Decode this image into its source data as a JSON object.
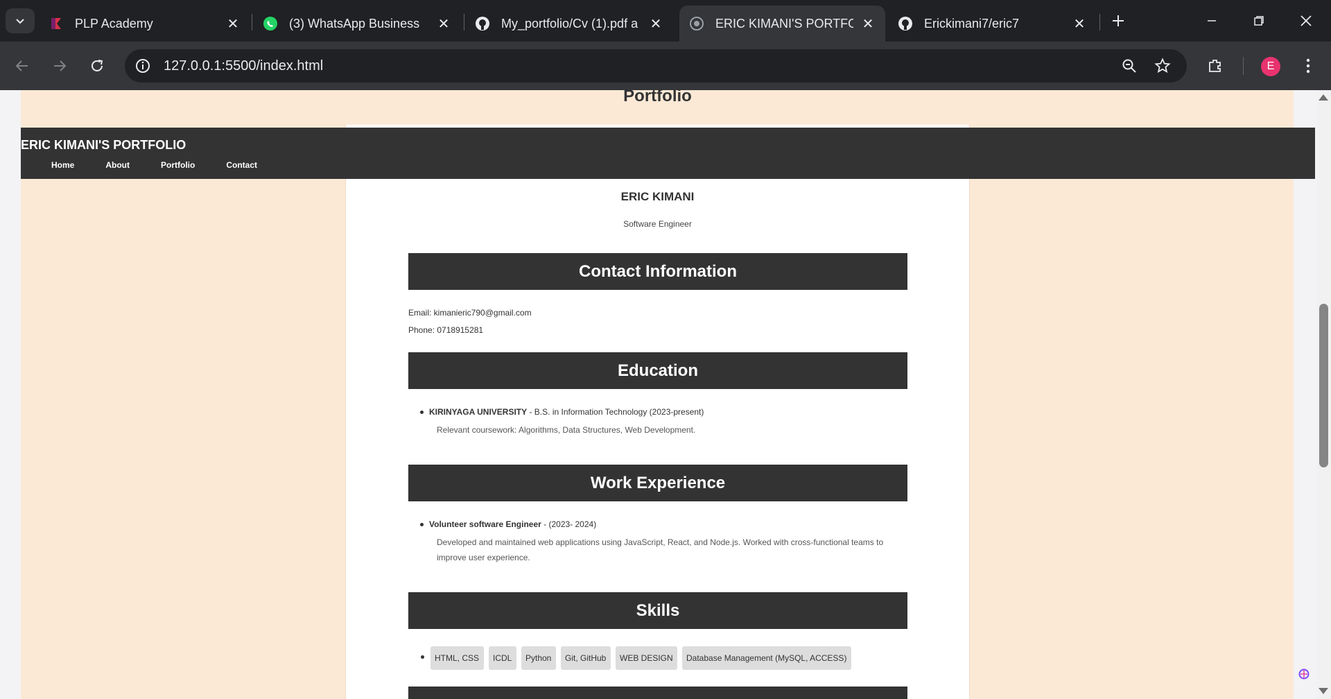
{
  "browser": {
    "tabs": [
      {
        "title": "PLP Academy",
        "icon": "plp-icon"
      },
      {
        "title": "(3) WhatsApp Business",
        "icon": "whatsapp-icon"
      },
      {
        "title": "My_portfolio/Cv (1).pdf a",
        "icon": "github-icon"
      },
      {
        "title": "ERIC KIMANI'S PORTFOLI",
        "icon": "globe-icon",
        "active": true
      },
      {
        "title": "Erickimani7/eric7",
        "icon": "github-icon"
      }
    ],
    "url": "127.0.0.1:5500/index.html",
    "profile_initial": "E"
  },
  "page": {
    "portfolio_heading": "Portfolio",
    "nav": {
      "brand": "ERIC KIMANI'S PORTFOLIO",
      "links": [
        "Home",
        "About",
        "Portfolio",
        "Contact"
      ]
    },
    "name": "ERIC KIMANI",
    "role": "Software Engineer",
    "contact": {
      "heading": "Contact Information",
      "email": "Email: kimanieric790@gmail.com",
      "phone": "Phone: 0718915281"
    },
    "education": {
      "heading": "Education",
      "school": "KIRINYAGA UNIVERSITY",
      "detail": " - B.S. in Information Technology (2023-present)",
      "coursework": "Relevant coursework: Algorithms, Data Structures, Web Development."
    },
    "work": {
      "heading": "Work Experience",
      "title": "Volunteer software Engineer",
      "period": " - (2023- 2024)",
      "desc_line1": "Developed and maintained web applications using JavaScript, React, and Node.js. Worked with cross-functional teams to",
      "desc_line2": "improve user experience."
    },
    "skills": {
      "heading": "Skills",
      "items": [
        "HTML, CSS",
        "ICDL",
        "Python",
        "Git, GitHub",
        "WEB DESIGN",
        "Database Management (MySQL, ACCESS)"
      ]
    }
  }
}
